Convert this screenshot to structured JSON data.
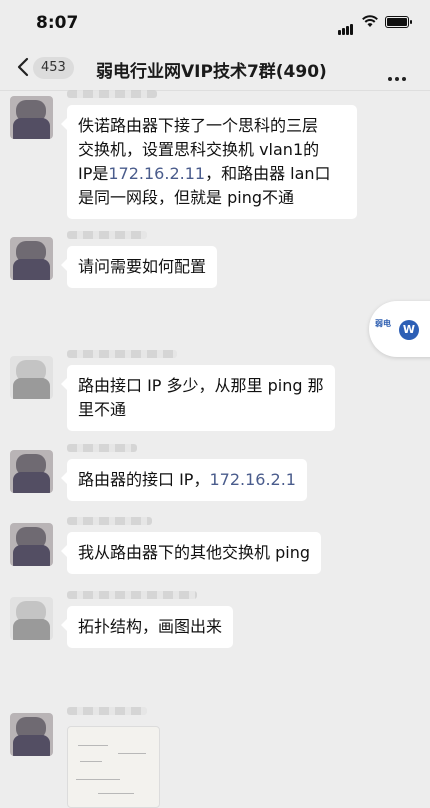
{
  "status": {
    "time": "8:07"
  },
  "nav": {
    "back_count": "453",
    "title": "弱电行业网VIP技术7群(490)"
  },
  "messages": [
    {
      "lines": [
        "佚诺路由器下接了一个思科的三层",
        "交换机，设置思科交换机 vlan1的"
      ],
      "line3_pre": "IP是",
      "line3_ip": "172.16.2.11",
      "line3_post": "，和路由器 lan口",
      "line4": "是同一网段，但就是 ping不通"
    },
    {
      "text": "请问需要如何配置"
    },
    {
      "lines": [
        "路由接口 IP 多少，从那里 ping 那",
        "里不通"
      ]
    },
    {
      "pre": "路由器的接口 IP，",
      "ip": "172.16.2.1"
    },
    {
      "text": "我从路由器下的其他交换机 ping"
    },
    {
      "text": "拓扑结构，画图出来"
    }
  ],
  "float_widget": {
    "badge": "W",
    "logo": "弱电"
  }
}
